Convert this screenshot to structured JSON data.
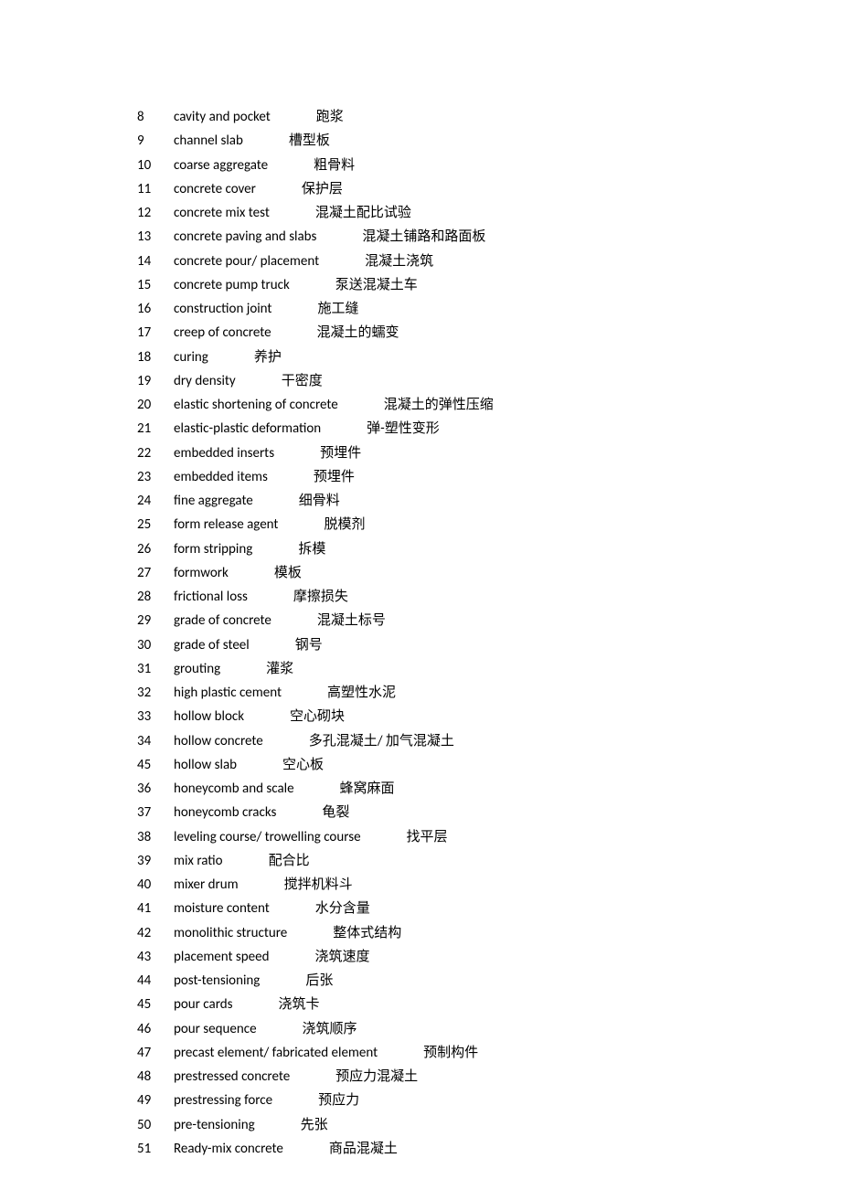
{
  "entries": [
    {
      "n": "8",
      "en": "cavity and pocket",
      "zh": "跑浆"
    },
    {
      "n": "9",
      "en": "channel slab",
      "zh": "槽型板"
    },
    {
      "n": "10",
      "en": "coarse aggregate",
      "zh": "粗骨料"
    },
    {
      "n": "11",
      "en": "concrete cover",
      "zh": "保护层"
    },
    {
      "n": "12",
      "en": "concrete mix test",
      "zh": "混凝土配比试验"
    },
    {
      "n": "13",
      "en": "concrete paving and slabs",
      "zh": "混凝土铺路和路面板"
    },
    {
      "n": "14",
      "en": "concrete pour/ placement",
      "zh": "混凝土浇筑"
    },
    {
      "n": "15",
      "en": "concrete pump truck",
      "zh": "泵送混凝土车"
    },
    {
      "n": "16",
      "en": "construction joint",
      "zh": "施工缝"
    },
    {
      "n": "17",
      "en": "creep of concrete",
      "zh": "混凝土的蠕变"
    },
    {
      "n": "18",
      "en": "curing",
      "zh": "养护"
    },
    {
      "n": "19",
      "en": "dry density",
      "zh": "干密度"
    },
    {
      "n": "20",
      "en": "elastic shortening of concrete",
      "zh": "混凝土的弹性压缩"
    },
    {
      "n": "21",
      "en": "elastic-plastic deformation",
      "zh": "弹-塑性变形"
    },
    {
      "n": "22",
      "en": "embedded inserts",
      "zh": "预埋件"
    },
    {
      "n": "23",
      "en": "embedded items",
      "zh": "预埋件"
    },
    {
      "n": "24",
      "en": "fine aggregate",
      "zh": "细骨料"
    },
    {
      "n": "25",
      "en": "form release agent",
      "zh": "脱模剂"
    },
    {
      "n": "26",
      "en": "form stripping",
      "zh": "拆模"
    },
    {
      "n": "27",
      "en": "formwork",
      "zh": "模板"
    },
    {
      "n": "28",
      "en": "frictional loss",
      "zh": "摩擦损失"
    },
    {
      "n": "29",
      "en": "grade of concrete",
      "zh": "混凝土标号"
    },
    {
      "n": "30",
      "en": "grade of steel",
      "zh": "钢号"
    },
    {
      "n": "31",
      "en": "grouting",
      "zh": "灌浆"
    },
    {
      "n": "32",
      "en": "high plastic cement",
      "zh": "高塑性水泥"
    },
    {
      "n": "33",
      "en": "hollow block",
      "zh": "空心砌块"
    },
    {
      "n": "34",
      "en": "hollow concrete",
      "zh": "多孔混凝土/ 加气混凝土"
    },
    {
      "n": "45",
      "en": "hollow slab",
      "zh": "空心板"
    },
    {
      "n": "36",
      "en": "honeycomb and scale",
      "zh": "蜂窝麻面"
    },
    {
      "n": "37",
      "en": "honeycomb cracks",
      "zh": "龟裂"
    },
    {
      "n": "38",
      "en": "leveling course/ trowelling course",
      "zh": "找平层"
    },
    {
      "n": "39",
      "en": "mix ratio",
      "zh": "配合比"
    },
    {
      "n": "40",
      "en": "mixer drum",
      "zh": "搅拌机料斗"
    },
    {
      "n": "41",
      "en": "moisture content",
      "zh": "水分含量"
    },
    {
      "n": "42",
      "en": "monolithic structure",
      "zh": "整体式结构"
    },
    {
      "n": "43",
      "en": "placement speed",
      "zh": "浇筑速度"
    },
    {
      "n": "44",
      "en": "post-tensioning",
      "zh": "后张"
    },
    {
      "n": "45",
      "en": "pour cards",
      "zh": "浇筑卡"
    },
    {
      "n": "46",
      "en": "pour sequence",
      "zh": "浇筑顺序"
    },
    {
      "n": "47",
      "en": "precast element/ fabricated element",
      "zh": "预制构件"
    },
    {
      "n": "48",
      "en": "prestressed concrete",
      "zh": "预应力混凝土"
    },
    {
      "n": "49",
      "en": "prestressing force",
      "zh": "预应力"
    },
    {
      "n": "50",
      "en": "pre-tensioning",
      "zh": "先张"
    },
    {
      "n": "51",
      "en": "Ready-mix concrete",
      "zh": "商品混凝土"
    }
  ]
}
